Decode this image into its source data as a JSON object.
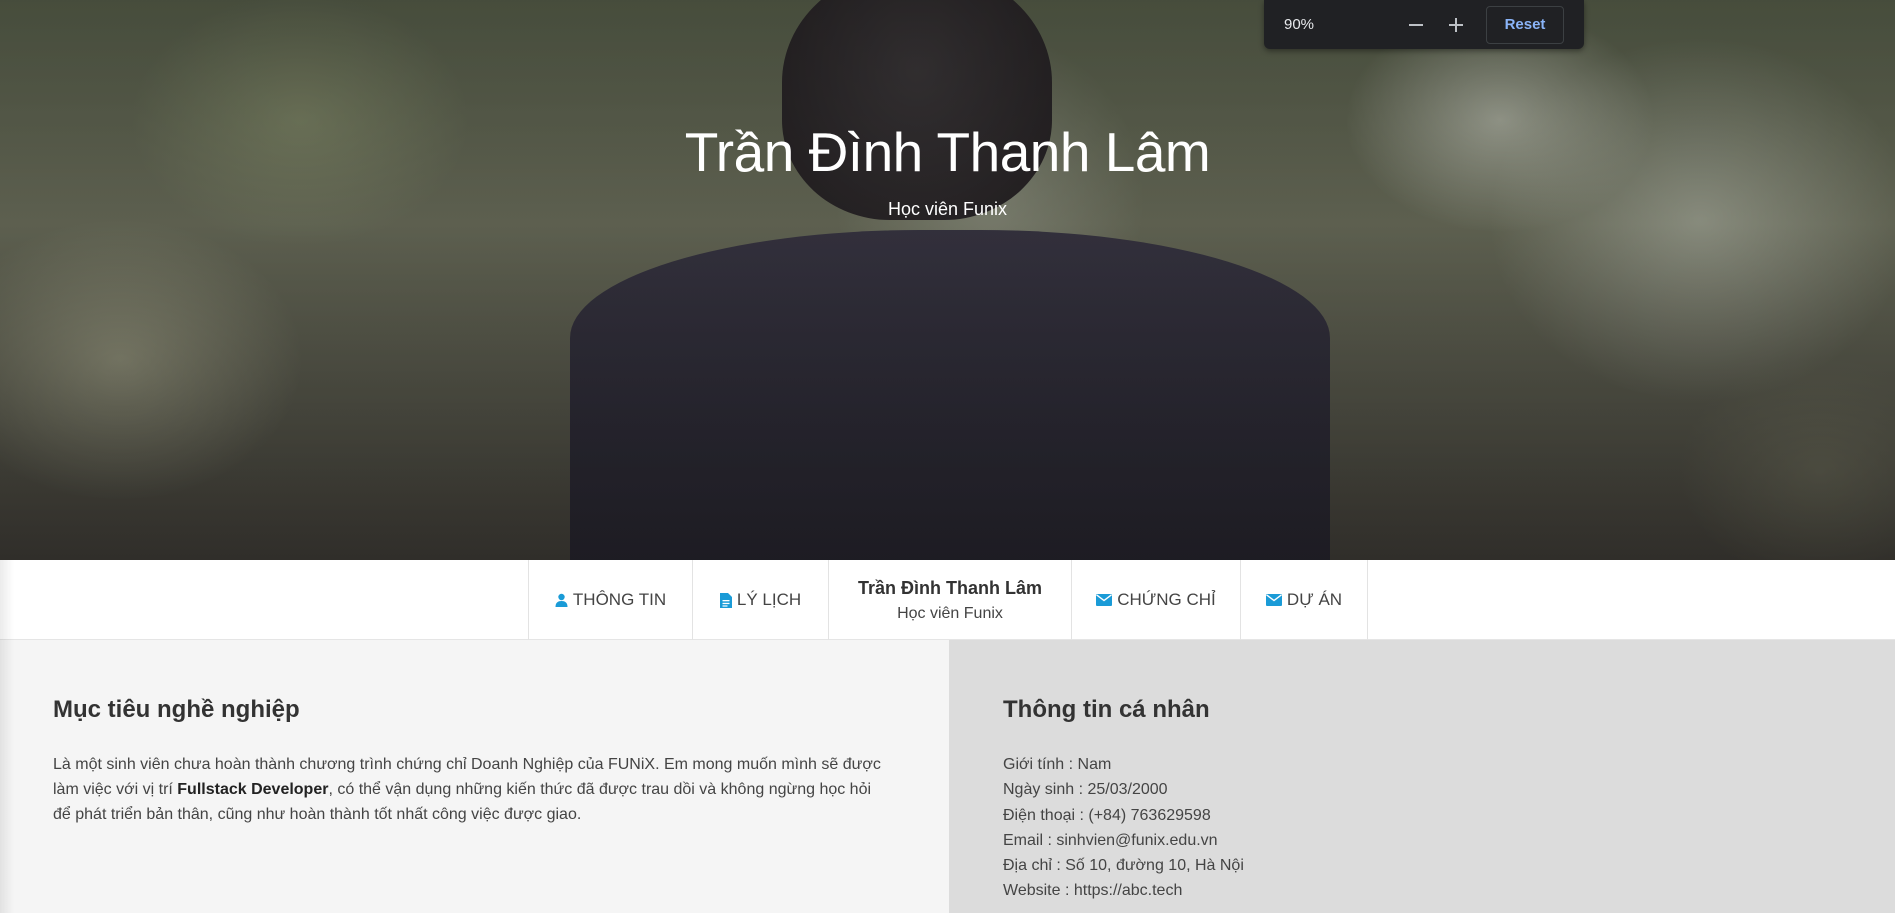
{
  "hero": {
    "title": "Trần Đình Thanh Lâm",
    "subtitle": "Học viên Funix"
  },
  "zoom": {
    "value": "90%",
    "reset_label": "Reset",
    "minus_icon": "minus-icon",
    "plus_icon": "plus-icon"
  },
  "nav": {
    "items": [
      {
        "label": "THÔNG TIN",
        "icon": "user-icon"
      },
      {
        "label": "LÝ LỊCH",
        "icon": "file-icon"
      },
      {
        "label": "CHỨNG CHỈ",
        "icon": "envelope-icon"
      },
      {
        "label": "DỰ ÁN",
        "icon": "envelope-icon"
      }
    ],
    "brand": {
      "name": "Trần Đình Thanh Lâm",
      "subtitle": "Học viên Funix"
    }
  },
  "career": {
    "title": "Mục tiêu nghề nghiệp",
    "text_before": "Là một sinh viên chưa hoàn thành chương trình chứng chỉ Doanh Nghiệp của FUNiX. Em mong muốn mình sẽ được làm việc với vị trí ",
    "highlight": "Fullstack Developer",
    "text_after": ", có thể vận dụng những kiến thức đã được trau dồi và không ngừng học hỏi để phát triển bản thân, cũng như hoàn thành tốt nhất công việc được giao."
  },
  "personal": {
    "title": "Thông tin cá nhân",
    "items": [
      "Giới tính : Nam",
      "Ngày sinh : 25/03/2000",
      "Điện thoại : (+84) 763629598",
      "Email : sinhvien@funix.edu.vn",
      "Địa chỉ : Số 10, đường 10, Hà Nội",
      "Website : https://abc.tech"
    ]
  },
  "colors": {
    "accent_icon": "#1a9bd7",
    "zoom_reset": "#8ab4f8",
    "left_bg": "#f5f5f5",
    "right_bg": "#dcdcdc"
  }
}
